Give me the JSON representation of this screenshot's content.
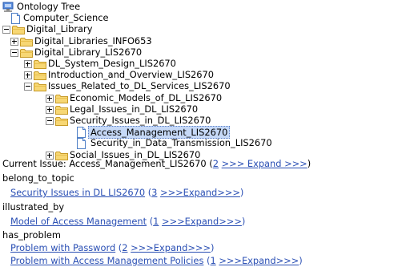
{
  "tree": {
    "title": "Ontology Tree",
    "nodes": {
      "computer_science": "Computer_Science",
      "digital_library": "Digital_Library",
      "dl_info653": "Digital_Libraries_INFO653",
      "dl_lis2670": "Digital_Library_LIS2670",
      "dl_system_design": "DL_System_Design_LIS2670",
      "intro_overview": "Introduction_and_Overview_LIS2670",
      "issues_dl_services": "Issues_Related_to_DL_Services_LIS2670",
      "economic_models": "Economic_Models_of_DL_LIS2670",
      "legal_issues": "Legal_Issues_in_DL_LIS2670",
      "security_issues": "Security_Issues_in_DL_LIS2670",
      "access_management": "Access_Management_LIS2670",
      "security_data_transmission": "Security_in_Data_Transmission_LIS2670",
      "social_issues": "Social_Issues_in_DL_LIS2670"
    }
  },
  "details": {
    "current_issue_label": "Current Issue: Access_Management_LIS2670",
    "current_issue_open": "(",
    "current_issue_count": "2",
    "current_issue_expand": ">>> Expand >>>",
    "current_issue_close": ")",
    "sections": [
      {
        "heading": "belong_to_topic",
        "items": [
          {
            "link": "Security Issues in DL LIS2670",
            "open": " (",
            "count": "3",
            "expand": ">>>Expand>>>",
            "close": ")"
          }
        ]
      },
      {
        "heading": "illustrated_by",
        "items": [
          {
            "link": "Model of Access Management",
            "open": " (",
            "count": "1",
            "expand": ">>>Expand>>>",
            "close": ")"
          }
        ]
      },
      {
        "heading": "has_problem",
        "items": [
          {
            "link": "Problem with Password",
            "open": " (",
            "count": "2",
            "expand": ">>>Expand>>>",
            "close": ")"
          },
          {
            "link": "Problem with Access Management Policies",
            "open": " (",
            "count": "1",
            "expand": ">>>Expand>>>",
            "close": ")"
          }
        ]
      }
    ]
  },
  "colors": {
    "link": "#2a4fb4",
    "selection_bg": "#c6d9f7",
    "folder_fill": "#f7d774",
    "folder_edge": "#c79a27"
  }
}
